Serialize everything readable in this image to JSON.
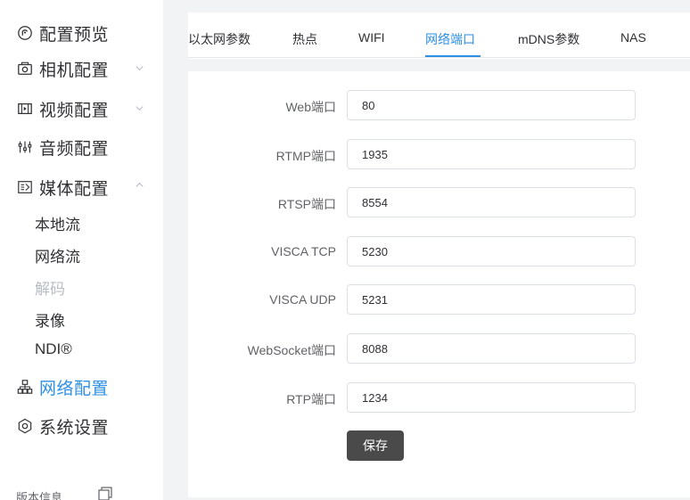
{
  "sidebar": {
    "items": [
      {
        "label": "配置预览",
        "icon": "preview-icon"
      },
      {
        "label": "相机配置",
        "icon": "camera-icon",
        "chevron": "down"
      },
      {
        "label": "视频配置",
        "icon": "video-icon",
        "chevron": "down"
      },
      {
        "label": "音频配置",
        "icon": "audio-sliders-icon"
      },
      {
        "label": "媒体配置",
        "icon": "media-icon",
        "chevron": "up"
      }
    ],
    "media_sub_items": [
      {
        "label": "本地流",
        "disabled": false
      },
      {
        "label": "网络流",
        "disabled": false
      },
      {
        "label": "解码",
        "disabled": true
      },
      {
        "label": "录像",
        "disabled": false
      },
      {
        "label": "NDI®",
        "disabled": false
      }
    ],
    "network": {
      "label": "网络配置",
      "icon": "network-icon",
      "active": true
    },
    "system": {
      "label": "系统设置",
      "icon": "settings-icon"
    },
    "version_label": "版本信息"
  },
  "tabs": {
    "items": [
      "以太网参数",
      "热点",
      "WIFI",
      "网络端口",
      "mDNS参数",
      "NAS"
    ],
    "active": "网络端口"
  },
  "form": {
    "rows": [
      {
        "label": "Web端口",
        "value": "80"
      },
      {
        "label": "RTMP端口",
        "value": "1935"
      },
      {
        "label": "RTSP端口",
        "value": "8554"
      },
      {
        "label": "VISCA TCP",
        "value": "5230"
      },
      {
        "label": "VISCA UDP",
        "value": "5231"
      },
      {
        "label": "WebSocket端口",
        "value": "8088"
      },
      {
        "label": "RTP端口",
        "value": "1234"
      }
    ],
    "save_label": "保存"
  },
  "colors": {
    "accent": "#2e8fe6",
    "background": "#f2f3f5",
    "save_button": "#4a4a4a",
    "disabled_text": "#b8bcc3"
  }
}
